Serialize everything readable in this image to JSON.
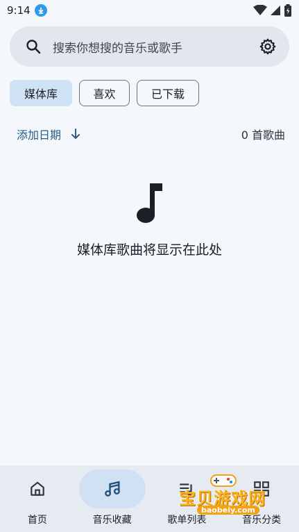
{
  "status_bar": {
    "time": "9:14"
  },
  "search": {
    "placeholder": "搜索你想搜的音乐或歌手"
  },
  "chips": [
    {
      "label": "媒体库",
      "selected": true
    },
    {
      "label": "喜欢",
      "selected": false
    },
    {
      "label": "已下载",
      "selected": false
    }
  ],
  "sort": {
    "label": "添加日期",
    "direction": "descending"
  },
  "song_count": "0 首歌曲",
  "empty_state": {
    "message": "媒体库歌曲将显示在此处",
    "icon": "music-note-icon"
  },
  "bottom_nav": [
    {
      "label": "首页",
      "icon": "home-icon",
      "active": false
    },
    {
      "label": "音乐收藏",
      "icon": "music-collection-icon",
      "active": true
    },
    {
      "label": "歌单列表",
      "icon": "playlist-icon",
      "active": false
    },
    {
      "label": "音乐分类",
      "icon": "category-icon",
      "active": false
    }
  ],
  "watermark": {
    "text": "宝贝游戏网",
    "url": "baobeiy.com"
  },
  "colors": {
    "accent": "#2a5d86",
    "selected_chip": "#d0e2f5",
    "background": "#f4f8fd"
  }
}
